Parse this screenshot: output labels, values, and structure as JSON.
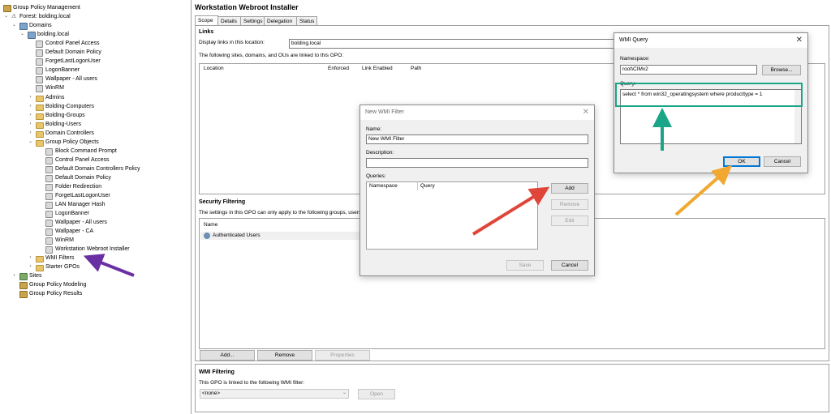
{
  "tree": {
    "root": "Group Policy Management",
    "forest": "Forest: bolding.local",
    "domains": "Domains",
    "domain": "bolding.local",
    "domain_links": [
      "Control Panel Access",
      "Default Domain Policy",
      "ForgetLastLogonUser",
      "LogonBanner",
      "Wallpaper - All users",
      "WinRM"
    ],
    "ous": [
      "Admins",
      "Bolding-Computers",
      "Bolding-Groups",
      "Bolding-Users",
      "Domain Controllers"
    ],
    "gpo_container": "Group Policy Objects",
    "gpos": [
      "Block Command Prompt",
      "Control Panel Access",
      "Default Domain Controllers Policy",
      "Default Domain Policy",
      "Folder Redirection",
      "ForgetLastLogonUser",
      "LAN Manager Hash",
      "LogonBanner",
      "Wallpaper - All users",
      "Wallpaper - CA",
      "WinRM",
      "Workstation Webroot Installer"
    ],
    "wmi_filters": "WMI Filters",
    "starter_gpos": "Starter GPOs",
    "sites": "Sites",
    "modeling": "Group Policy Modeling",
    "results": "Group Policy Results"
  },
  "gpo": {
    "title": "Workstation Webroot Installer",
    "tabs": [
      "Scope",
      "Details",
      "Settings",
      "Delegation",
      "Status"
    ],
    "links": {
      "heading": "Links",
      "display_label": "Display links in this location:",
      "display_value": "bolding.local",
      "linked_text": "The following sites, domains, and OUs are linked to this GPO:",
      "columns": [
        "Location",
        "Enforced",
        "Link Enabled",
        "Path"
      ]
    },
    "security": {
      "heading": "Security Filtering",
      "text": "The settings in this GPO can only apply to the following groups, users",
      "column": "Name",
      "rows": [
        "Authenticated Users"
      ],
      "buttons": [
        "Add...",
        "Remove",
        "Properties"
      ]
    },
    "wmi": {
      "heading": "WMI Filtering",
      "text": "This GPO is linked to the following WMI filter:",
      "select": "<none>",
      "open": "Open"
    }
  },
  "new_wmi_filter": {
    "title": "New WMI Filter",
    "name_label": "Name:",
    "name_value": "New WMI Filter",
    "desc_label": "Description:",
    "desc_value": "",
    "queries_label": "Queries:",
    "columns": [
      "Namespace",
      "Query"
    ],
    "buttons": {
      "add": "Add",
      "remove": "Remove",
      "edit": "Edit",
      "save": "Save",
      "cancel": "Cancel"
    }
  },
  "wmi_query": {
    "title": "WMI Query",
    "namespace_label": "Namespace:",
    "namespace_value": "root\\CIMv2",
    "browse": "Browse...",
    "query_label": "Query:",
    "query_value": "select * from win32_operatingsystem where producttype = 1",
    "ok": "OK",
    "cancel": "Cancel"
  },
  "annotation_colors": {
    "purple": "#6a2fa3",
    "red": "#e0453a",
    "green": "#1aa588",
    "orange": "#f0a830"
  }
}
